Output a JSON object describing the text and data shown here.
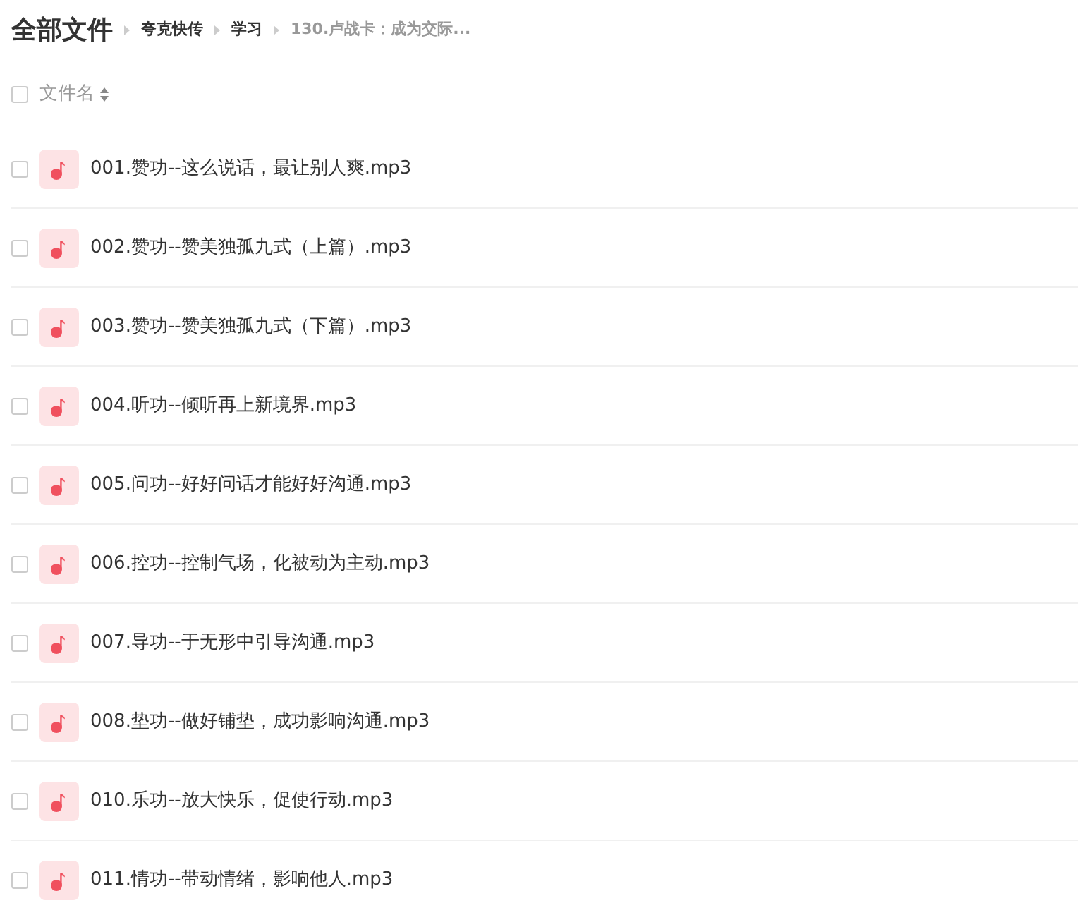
{
  "title": "全部文件",
  "breadcrumb": [
    {
      "label": "夸克快传",
      "current": false
    },
    {
      "label": "学习",
      "current": false
    },
    {
      "label": "130.卢战卡：成为交际...",
      "current": true
    }
  ],
  "header": {
    "checked": false,
    "column": "文件名"
  },
  "files": [
    {
      "name": "001.赞功--这么说话，最让别人爽.mp3",
      "checked": false
    },
    {
      "name": "002.赞功--赞美独孤九式（上篇）.mp3",
      "checked": false
    },
    {
      "name": "003.赞功--赞美独孤九式（下篇）.mp3",
      "checked": false
    },
    {
      "name": "004.听功--倾听再上新境界.mp3",
      "checked": false
    },
    {
      "name": "005.问功--好好问话才能好好沟通.mp3",
      "checked": false
    },
    {
      "name": "006.控功--控制气场，化被动为主动.mp3",
      "checked": false
    },
    {
      "name": "007.导功--于无形中引导沟通.mp3",
      "checked": false
    },
    {
      "name": "008.垫功--做好铺垫，成功影响沟通.mp3",
      "checked": false
    },
    {
      "name": "010.乐功--放大快乐，促使行动.mp3",
      "checked": false
    },
    {
      "name": "011.情功--带动情绪，影响他人.mp3",
      "checked": false
    }
  ]
}
